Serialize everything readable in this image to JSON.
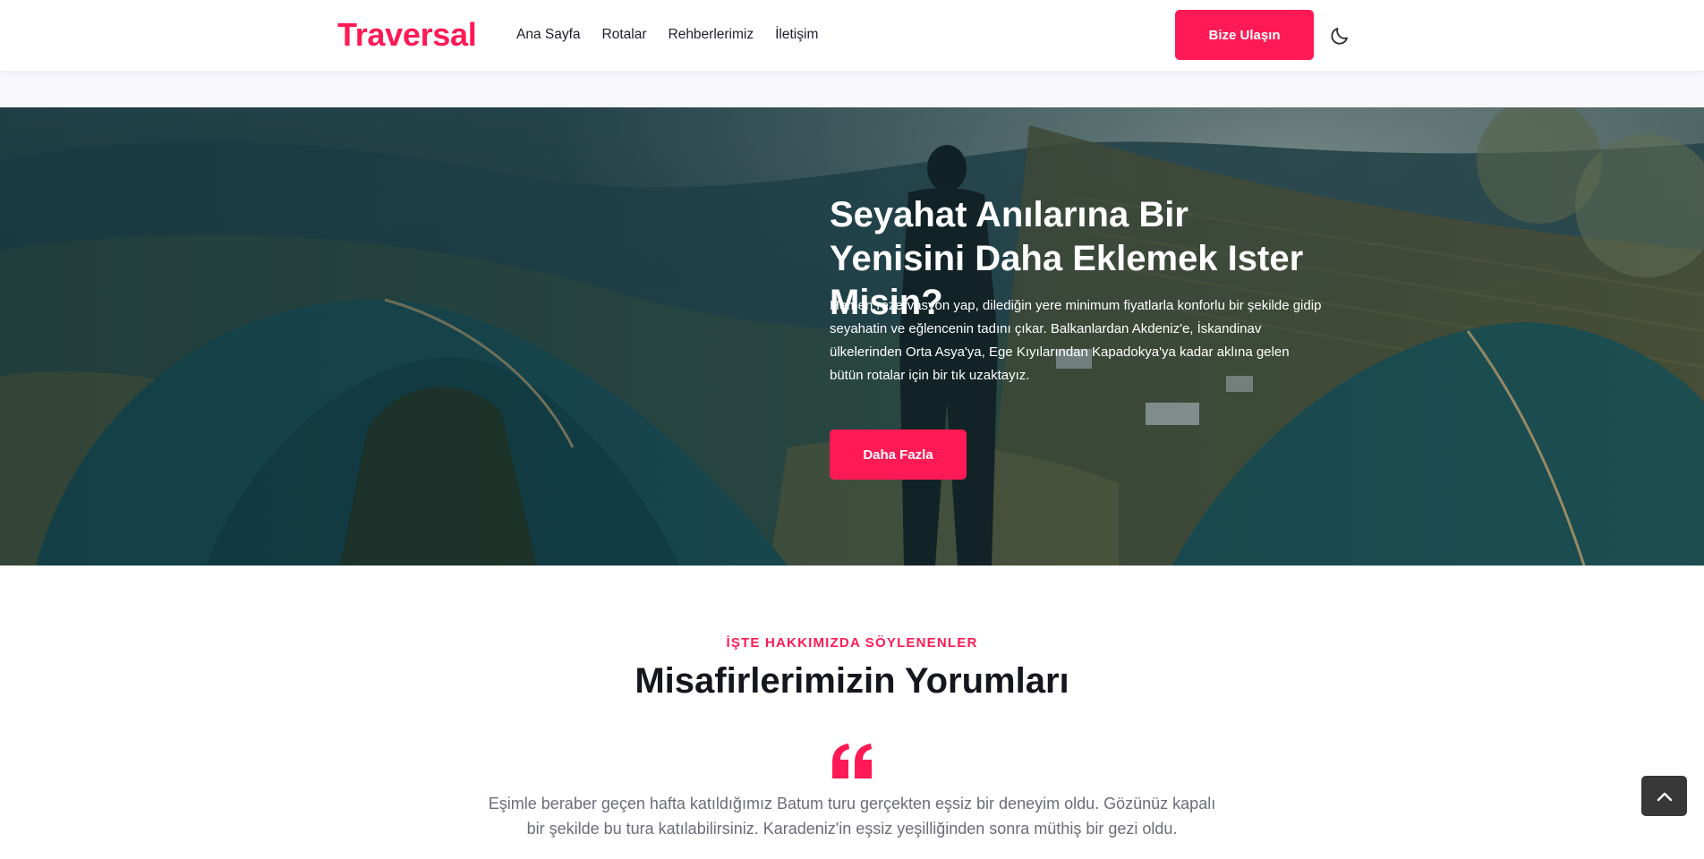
{
  "header": {
    "logo": "Traversal",
    "nav": [
      {
        "label": "Ana Sayfa"
      },
      {
        "label": "Rotalar"
      },
      {
        "label": "Rehberlerimiz"
      },
      {
        "label": "İletişim"
      }
    ],
    "cta_label": "Bize Ulaşın",
    "theme_toggle_icon": "moon-icon"
  },
  "hero": {
    "title": "Seyahat Anılarına Bir Yenisini Daha Eklemek Ister Misin?",
    "text": "Hemen rezervasyon yap, dilediğin yere minimum fiyatlarla konforlu bir şekilde gidip seyahatin ve eğlencenin tadını çıkar. Balkanlardan Akdeniz'e, İskandinav ülkelerinden Orta Asya'ya, Ege Kıyılarından Kapadokya'ya kadar aklına gelen bütün rotalar için bir tık uzaktayız.",
    "button_label": "Daha Fazla",
    "background_image": "camping-tents-mountain-photo"
  },
  "testimonials": {
    "eyebrow": "İŞTE HAKKIMIZDA SÖYLENENLER",
    "title": "Misafirlerimizin Yorumları",
    "quote_icon": "quote-icon",
    "quote": "Eşimle beraber geçen hafta katıldığımız Batum turu gerçekten eşsiz bir deneyim oldu. Gözünüz kapalı bir şekilde bu tura katılabilirsiniz. Karadeniz'in eşsiz yeşilliğinden sonra müthiş bir gezi oldu."
  },
  "scroll_top_icon": "chevron-up-icon",
  "colors": {
    "accent": "#ff1a55",
    "text_dark": "#16161e",
    "text_muted": "#6c6c78",
    "scroll_button": "#383838"
  }
}
